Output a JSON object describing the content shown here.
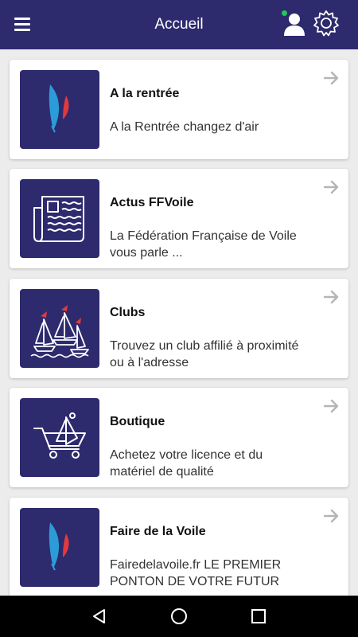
{
  "appbar": {
    "title": "Accueil",
    "menu_icon": "hamburger-menu-icon",
    "user_icon": "user-icon",
    "settings_icon": "gear-icon",
    "online_color": "#22c55e"
  },
  "colors": {
    "brand": "#2e2a6e",
    "sail_blue": "#2b9cd8",
    "sail_red": "#e03a3e"
  },
  "cards": [
    {
      "title": "A la rentrée",
      "description": "A la Rentrée changez d'air",
      "icon": "ffvoile-sail-logo-icon"
    },
    {
      "title": "Actus FFVoile",
      "description": "La Fédération Française de Voile vous parle ...",
      "icon": "newspaper-icon"
    },
    {
      "title": "Clubs",
      "description": "Trouvez un club affilié à proximité ou à l'adresse",
      "icon": "sailboats-icon"
    },
    {
      "title": "Boutique",
      "description": "Achetez votre licence et du matériel de qualité",
      "icon": "shopping-cart-icon"
    },
    {
      "title": "Faire de la Voile",
      "description": "Fairedelavoile.fr LE PREMIER PONTON DE VOTRE FUTUR",
      "icon": "ffvoile-sail-logo-icon"
    }
  ],
  "navbar": {
    "back_icon": "back-triangle-icon",
    "home_icon": "home-circle-icon",
    "recents_icon": "recents-square-icon"
  }
}
